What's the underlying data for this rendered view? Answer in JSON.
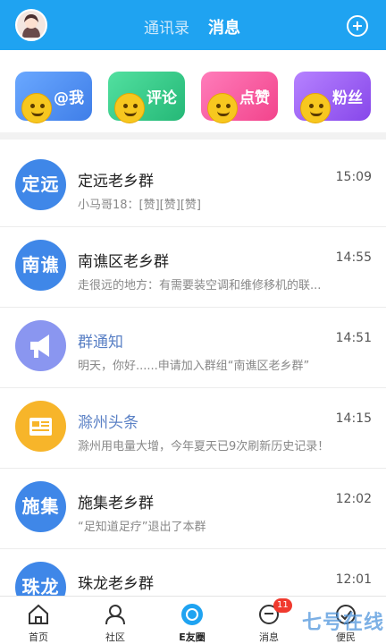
{
  "header": {
    "tab_contacts": "通讯录",
    "tab_messages": "消息"
  },
  "tiles": [
    {
      "label": "@我",
      "color": "#4f8ff0"
    },
    {
      "label": "评论",
      "color": "#31c98a"
    },
    {
      "label": "点赞",
      "color": "#ff5aa0"
    },
    {
      "label": "粉丝",
      "color": "#9b5ef5"
    }
  ],
  "messages": [
    {
      "icon_text": "定远",
      "icon_color": "#3f87e8",
      "title": "定远老乡群",
      "preview": "小马哥18：[赞][赞][赞]",
      "time": "15:09"
    },
    {
      "icon_text": "南谯",
      "icon_color": "#3f87e8",
      "title": "南谯区老乡群",
      "preview": "走很远的地方：有需要装空调和维修移机的联...",
      "time": "14:55"
    },
    {
      "icon_text": "",
      "icon_color": "#8a96f0",
      "title": "群通知",
      "preview": "明天，你好......申请加入群组“南谯区老乡群”",
      "time": "14:51"
    },
    {
      "icon_text": "",
      "icon_color": "#f7b52a",
      "title": "滁州头条",
      "preview": "滁州用电量大增，今年夏天已9次刷新历史记录！",
      "time": "14:15"
    },
    {
      "icon_text": "施集",
      "icon_color": "#3f87e8",
      "title": "施集老乡群",
      "preview": "“足知道足疗”退出了本群",
      "time": "12:02"
    },
    {
      "icon_text": "珠龙",
      "icon_color": "#3f87e8",
      "title": "珠龙老乡群",
      "preview": "",
      "time": "12:01"
    }
  ],
  "nav": {
    "home": "首页",
    "community": "社区",
    "friends": "E友圈",
    "messages": "消息",
    "services": "便民",
    "badge": "11"
  },
  "watermark": "七号在线"
}
